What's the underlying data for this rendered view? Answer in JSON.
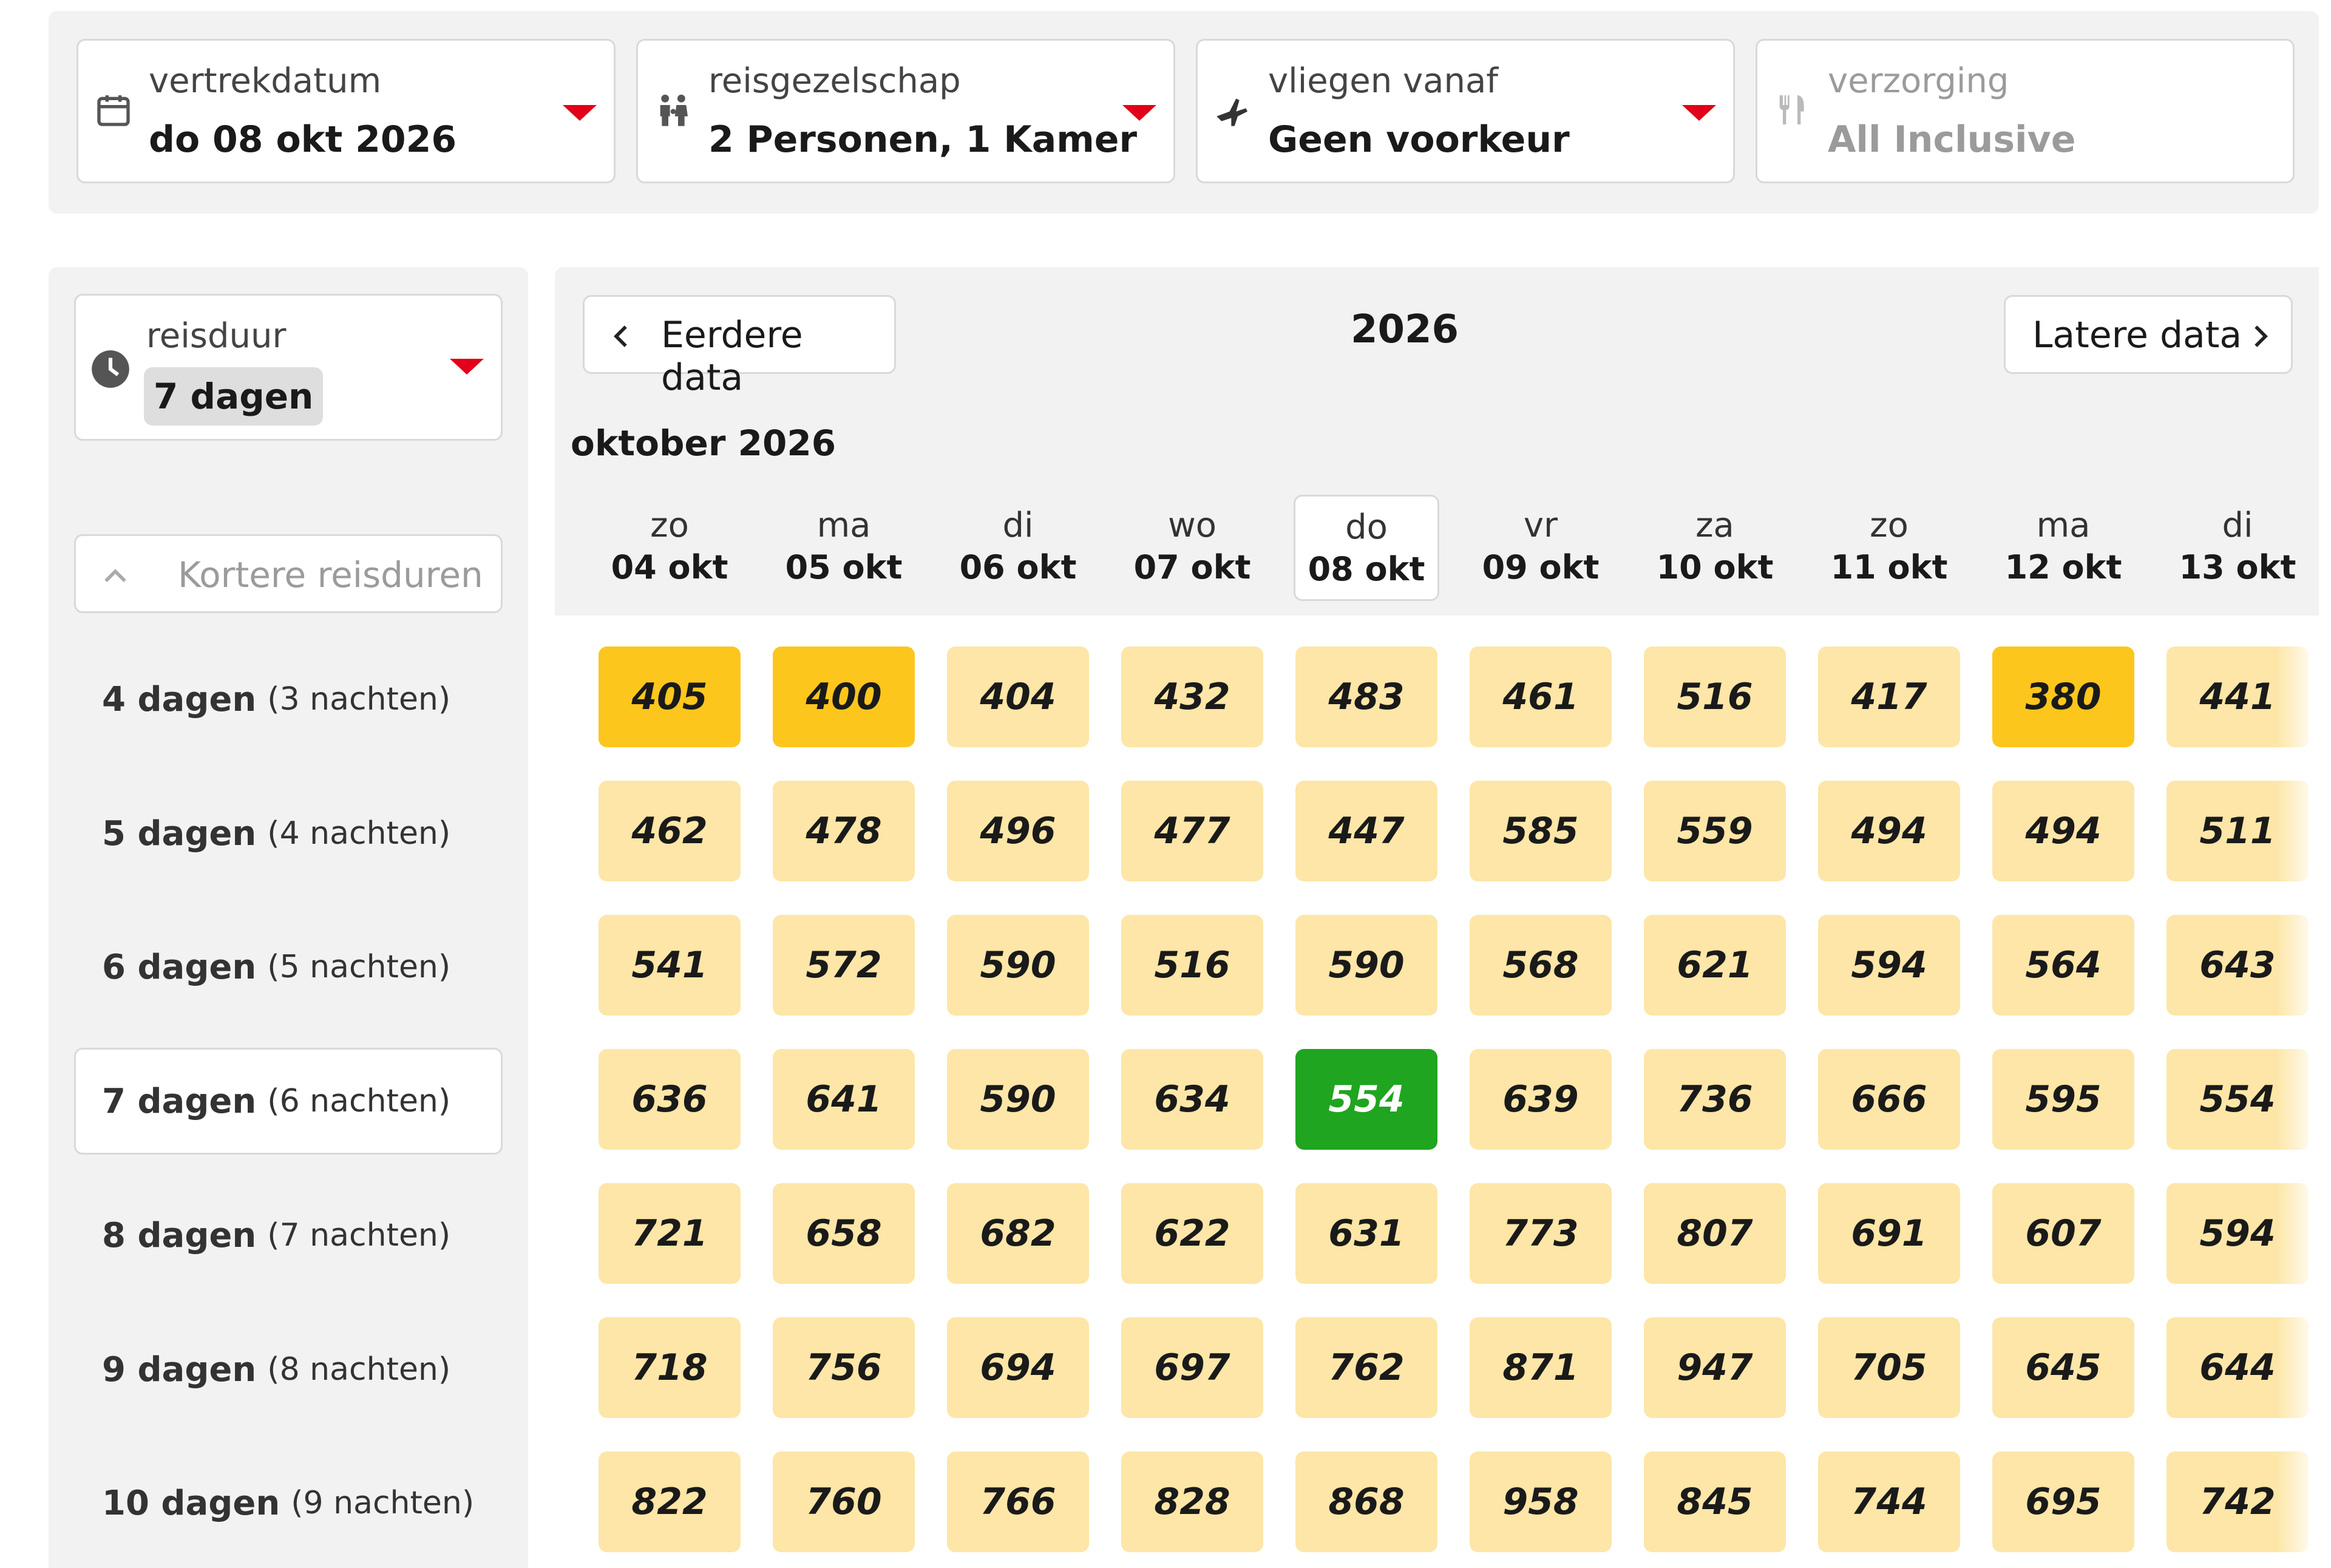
{
  "filters": [
    {
      "label": "vertrekdatum",
      "value": "do 08 okt 2026",
      "icon": "calendar-icon",
      "enabled": true
    },
    {
      "label": "reisgezelschap",
      "value": "2 Personen, 1 Kamer",
      "icon": "family-icon",
      "enabled": true
    },
    {
      "label": "vliegen vanaf",
      "value": "Geen voorkeur",
      "icon": "airplane-icon",
      "enabled": true
    },
    {
      "label": "verzorging",
      "value": "All Inclusive",
      "icon": "cutlery-icon",
      "enabled": false
    }
  ],
  "sidebar": {
    "duration_label": "reisduur",
    "duration_value": "7 dagen",
    "shorter_label": "Kortere reisduren",
    "durations": [
      {
        "days": "4 dagen",
        "nights": "(3 nachten)"
      },
      {
        "days": "5 dagen",
        "nights": "(4 nachten)"
      },
      {
        "days": "6 dagen",
        "nights": "(5 nachten)"
      },
      {
        "days": "7 dagen",
        "nights": "(6 nachten)"
      },
      {
        "days": "8 dagen",
        "nights": "(7 nachten)"
      },
      {
        "days": "9 dagen",
        "nights": "(8 nachten)"
      },
      {
        "days": "10 dagen",
        "nights": "(9 nachten)"
      }
    ],
    "selected_index": 3
  },
  "calendar": {
    "prev_label": "Eerdere data",
    "next_label": "Latere data",
    "year": "2026",
    "month": "oktober 2026",
    "days": [
      {
        "wd": "zo",
        "dt": "04 okt"
      },
      {
        "wd": "ma",
        "dt": "05 okt"
      },
      {
        "wd": "di",
        "dt": "06 okt"
      },
      {
        "wd": "wo",
        "dt": "07 okt"
      },
      {
        "wd": "do",
        "dt": "08 okt"
      },
      {
        "wd": "vr",
        "dt": "09 okt"
      },
      {
        "wd": "za",
        "dt": "10 okt"
      },
      {
        "wd": "zo",
        "dt": "11 okt"
      },
      {
        "wd": "ma",
        "dt": "12 okt"
      },
      {
        "wd": "di",
        "dt": "13 okt"
      }
    ],
    "selected_day_index": 4,
    "prices": [
      [
        "405",
        "400",
        "404",
        "432",
        "483",
        "461",
        "516",
        "417",
        "380",
        "441"
      ],
      [
        "462",
        "478",
        "496",
        "477",
        "447",
        "585",
        "559",
        "494",
        "494",
        "511"
      ],
      [
        "541",
        "572",
        "590",
        "516",
        "590",
        "568",
        "621",
        "594",
        "564",
        "643"
      ],
      [
        "636",
        "641",
        "590",
        "634",
        "554",
        "639",
        "736",
        "666",
        "595",
        "554"
      ],
      [
        "721",
        "658",
        "682",
        "622",
        "631",
        "773",
        "807",
        "691",
        "607",
        "594"
      ],
      [
        "718",
        "756",
        "694",
        "697",
        "762",
        "871",
        "947",
        "705",
        "645",
        "644"
      ],
      [
        "822",
        "760",
        "766",
        "828",
        "868",
        "958",
        "845",
        "744",
        "695",
        "742"
      ]
    ],
    "lowest_price_cells": [
      [
        0,
        0
      ],
      [
        0,
        1
      ],
      [
        0,
        8
      ]
    ],
    "selected_cell": [
      3,
      4
    ]
  },
  "colors": {
    "accent_red": "#e2001a",
    "price_cell": "#fde6a7",
    "lowest_price": "#fdc61d",
    "selected_price": "#1fa51f"
  }
}
